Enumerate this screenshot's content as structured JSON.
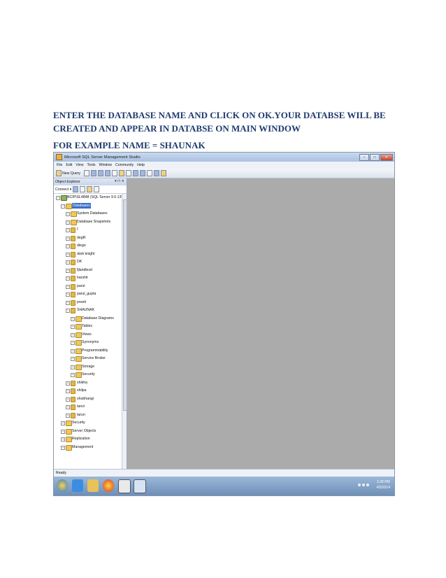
{
  "document": {
    "instruction": "ENTER THE DATABASE NAME AND CLICK ON OK.YOUR DATABSE WILL BE CREATED AND APPEAR IN DATABSE ON MAIN WINDOW",
    "example": "FOR EXAMPLE NAME = SHAUNAK"
  },
  "window": {
    "title": "Microsoft SQL Server Management Studio",
    "menu": [
      "File",
      "Edit",
      "View",
      "Tools",
      "Window",
      "Community",
      "Help"
    ],
    "toolbar": {
      "new_query": "New Query"
    },
    "status": "Ready"
  },
  "object_explorer": {
    "title": "Object Explorer",
    "header_controls": "▾ ⊓ ✕",
    "connect": "Connect ▾",
    "tree": [
      {
        "label": "BCIP\\SL4848 (SQL Server 9.0.1399 - MASTE",
        "depth": 0,
        "expander": "−",
        "icon": "server"
      },
      {
        "label": "Databases",
        "depth": 1,
        "expander": "−",
        "icon": "folder",
        "selected": true
      },
      {
        "label": "System Databases",
        "depth": 2,
        "expander": "+",
        "icon": "folder"
      },
      {
        "label": "Database Snapshots",
        "depth": 2,
        "expander": "+",
        "icon": "folder"
      },
      {
        "label": "i'",
        "depth": 2,
        "expander": "+",
        "icon": "db"
      },
      {
        "label": "degR",
        "depth": 2,
        "expander": "+",
        "icon": "db"
      },
      {
        "label": "diego",
        "depth": 2,
        "expander": "+",
        "icon": "db"
      },
      {
        "label": "dark knight",
        "depth": 2,
        "expander": "+",
        "icon": "db"
      },
      {
        "label": "DK",
        "depth": 2,
        "expander": "+",
        "icon": "db"
      },
      {
        "label": "fjlandlesd",
        "depth": 2,
        "expander": "+",
        "icon": "db"
      },
      {
        "label": "harshit",
        "depth": 2,
        "expander": "+",
        "icon": "db"
      },
      {
        "label": "parul",
        "depth": 2,
        "expander": "+",
        "icon": "db"
      },
      {
        "label": "parul_gupta",
        "depth": 2,
        "expander": "+",
        "icon": "db"
      },
      {
        "label": "preeti",
        "depth": 2,
        "expander": "+",
        "icon": "db"
      },
      {
        "label": "SHAUNAK",
        "depth": 2,
        "expander": "−",
        "icon": "db"
      },
      {
        "label": "Database Diagrams",
        "depth": 3,
        "expander": "+",
        "icon": "folder"
      },
      {
        "label": "Tables",
        "depth": 3,
        "expander": "+",
        "icon": "folder"
      },
      {
        "label": "Views",
        "depth": 3,
        "expander": "+",
        "icon": "folder"
      },
      {
        "label": "Synonyms",
        "depth": 3,
        "expander": "+",
        "icon": "folder"
      },
      {
        "label": "Programmability",
        "depth": 3,
        "expander": "+",
        "icon": "folder"
      },
      {
        "label": "Service Broker",
        "depth": 3,
        "expander": "+",
        "icon": "folder"
      },
      {
        "label": "Storage",
        "depth": 3,
        "expander": "+",
        "icon": "folder"
      },
      {
        "label": "Security",
        "depth": 3,
        "expander": "+",
        "icon": "folder"
      },
      {
        "label": "shikha",
        "depth": 2,
        "expander": "+",
        "icon": "db"
      },
      {
        "label": "shilpa",
        "depth": 2,
        "expander": "+",
        "icon": "db"
      },
      {
        "label": "shubhangi",
        "depth": 2,
        "expander": "+",
        "icon": "db"
      },
      {
        "label": "tanvi",
        "depth": 2,
        "expander": "+",
        "icon": "db"
      },
      {
        "label": "tarun",
        "depth": 2,
        "expander": "+",
        "icon": "db"
      },
      {
        "label": "Security",
        "depth": 1,
        "expander": "+",
        "icon": "folder"
      },
      {
        "label": "Server Objects",
        "depth": 1,
        "expander": "+",
        "icon": "folder"
      },
      {
        "label": "Replication",
        "depth": 1,
        "expander": "+",
        "icon": "folder"
      },
      {
        "label": "Management",
        "depth": 1,
        "expander": "+",
        "icon": "folder"
      }
    ]
  },
  "taskbar": {
    "time": "1:28 PM",
    "date": "4/5/2014"
  }
}
